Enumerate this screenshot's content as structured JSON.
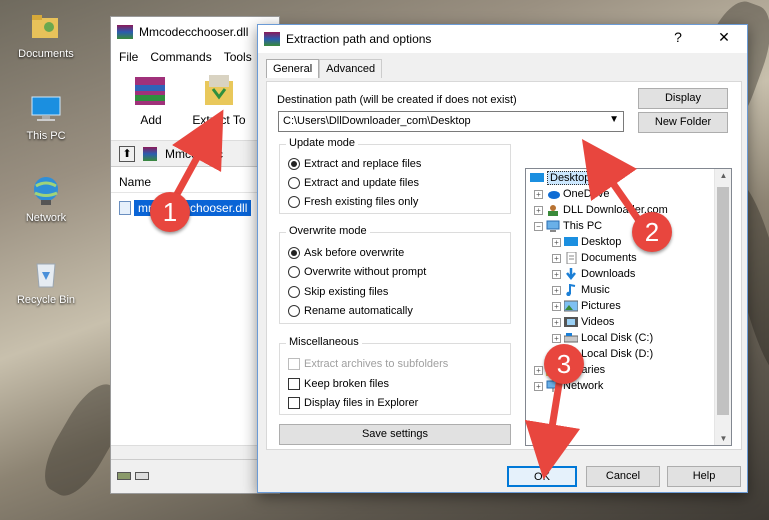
{
  "desktop": {
    "icons": [
      {
        "label": "Documents"
      },
      {
        "label": "This PC"
      },
      {
        "label": "Network"
      },
      {
        "label": "Recycle Bin"
      }
    ]
  },
  "winrar": {
    "title": "Mmcodecchooser.dll",
    "menu": [
      "File",
      "Commands",
      "Tools"
    ],
    "toolbar": [
      {
        "label": "Add",
        "icon": "add-archive-icon"
      },
      {
        "label": "Extract To",
        "icon": "extract-to-icon"
      }
    ],
    "path": "Mmcodecc",
    "column_name": "Name",
    "file": "mmcodecchooser.dll"
  },
  "dialog": {
    "title": "Extraction path and options",
    "help": "?",
    "close": "✕",
    "tabs": [
      "General",
      "Advanced"
    ],
    "dest_label": "Destination path (will be created if does not exist)",
    "dest_value": "C:\\Users\\DllDownloader_com\\Desktop",
    "display_btn": "Display",
    "new_folder_btn": "New Folder",
    "update_mode": {
      "title": "Update mode",
      "options": [
        "Extract and replace files",
        "Extract and update files",
        "Fresh existing files only"
      ],
      "selected": 0
    },
    "overwrite_mode": {
      "title": "Overwrite mode",
      "options": [
        "Ask before overwrite",
        "Overwrite without prompt",
        "Skip existing files",
        "Rename automatically"
      ],
      "selected": 0
    },
    "misc": {
      "title": "Miscellaneous",
      "options": [
        "Extract archives to subfolders",
        "Keep broken files",
        "Display files in Explorer"
      ]
    },
    "save_settings": "Save settings",
    "tree": [
      {
        "label": "Desktop",
        "icon": "desktop-icon"
      },
      {
        "label": "OneDrive",
        "icon": "onedrive-icon"
      },
      {
        "label": "DLL Downloader.com",
        "icon": "user-icon"
      },
      {
        "label": "This PC",
        "icon": "computer-icon"
      },
      {
        "label": "Desktop",
        "icon": "desktop-icon"
      },
      {
        "label": "Documents",
        "icon": "documents-icon"
      },
      {
        "label": "Downloads",
        "icon": "downloads-icon"
      },
      {
        "label": "Music",
        "icon": "music-icon"
      },
      {
        "label": "Pictures",
        "icon": "pictures-icon"
      },
      {
        "label": "Videos",
        "icon": "videos-icon"
      },
      {
        "label": "Local Disk (C:)",
        "icon": "drive-icon"
      },
      {
        "label": "Local Disk (D:)",
        "icon": "drive-icon"
      },
      {
        "label": "Libraries",
        "icon": "folder-icon"
      },
      {
        "label": "Network",
        "icon": "network-icon"
      }
    ],
    "ok": "OK",
    "cancel": "Cancel",
    "help_btn": "Help"
  },
  "annotations": {
    "steps": [
      "1",
      "2",
      "3"
    ],
    "color": "#e8463e"
  }
}
